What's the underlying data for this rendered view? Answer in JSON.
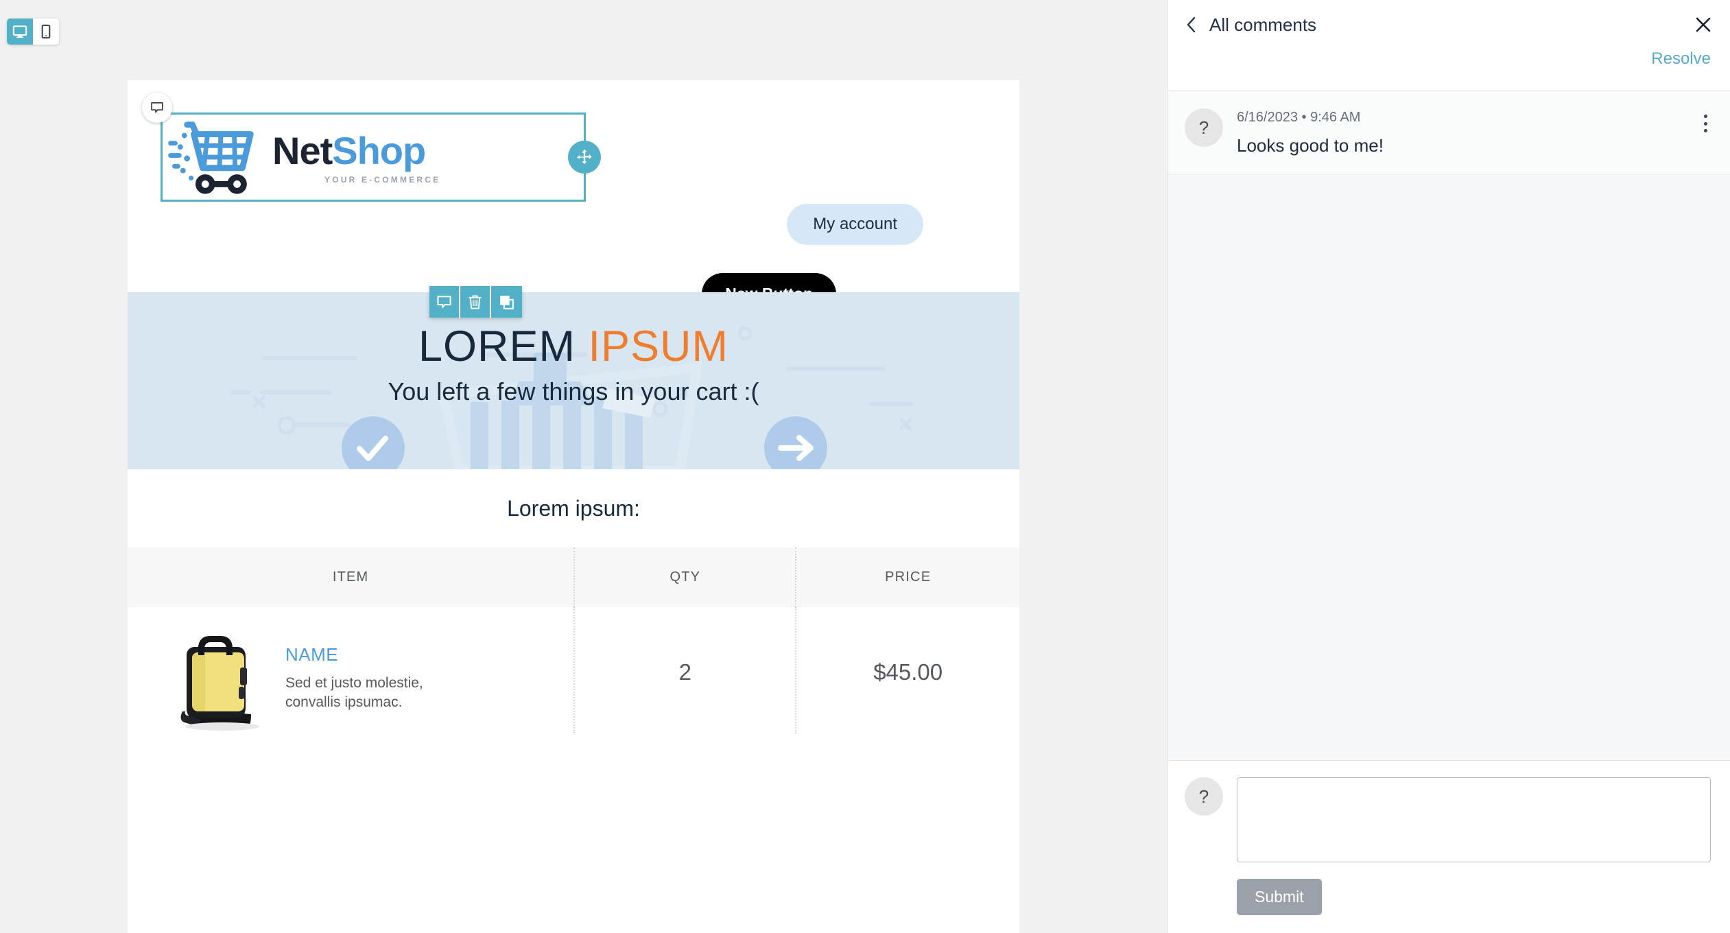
{
  "editor": {
    "device_toggle": {
      "desktop_label": "desktop-view",
      "mobile_label": "mobile-view",
      "active": "desktop",
      "active_color": "#52b0c7"
    },
    "block_toolbar": {
      "comment_label": "comment",
      "delete_label": "delete",
      "duplicate_label": "duplicate",
      "color": "#52b0c7"
    },
    "selection": {
      "border_color": "#52b0c7",
      "move_handle_label": "move",
      "comment_badge_label": "comment"
    }
  },
  "email": {
    "logo": {
      "name_part1": "Net",
      "name_part2": "Shop",
      "tagline": "YOUR E-COMMERCE",
      "color_part1": "#1b2430",
      "color_part2": "#4b9bdb"
    },
    "header_buttons": {
      "my_account": "My account",
      "new_button": "New Button"
    },
    "hero": {
      "title_part1": "LOREM",
      "title_part2": "IPSUM",
      "title_color1": "#17293a",
      "title_color2": "#f07d2e",
      "subtitle": "You left a few things in your cart :(",
      "background": "#d8e6f1"
    },
    "section_title": "Lorem ipsum:",
    "table": {
      "headers": [
        "ITEM",
        "QTY",
        "PRICE"
      ],
      "rows": [
        {
          "name": "NAME",
          "description": "Sed et justo molestie, convallis ipsumac.",
          "qty": "2",
          "price": "$45.00",
          "image_label": "yellow-laptop-bag"
        }
      ]
    }
  },
  "comments_panel": {
    "title": "All comments",
    "back_label": "back",
    "close_label": "close",
    "resolve_label": "Resolve",
    "resolve_color": "#5aa9c9",
    "comments": [
      {
        "avatar_initial": "?",
        "meta": "6/16/2023 • 9:46 AM",
        "text": "Looks good to me!"
      }
    ],
    "reply": {
      "avatar_initial": "?",
      "value": "",
      "placeholder": "",
      "submit_label": "Submit"
    }
  }
}
